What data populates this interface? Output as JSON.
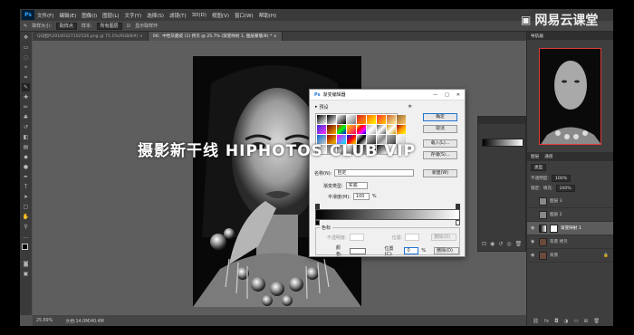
{
  "app": {
    "logo": "Ps"
  },
  "menu": [
    "文件(F)",
    "编辑(E)",
    "图像(I)",
    "图层(L)",
    "文字(Y)",
    "选择(S)",
    "滤镜(T)",
    "3D(D)",
    "视图(V)",
    "窗口(W)",
    "帮助(H)"
  ],
  "options": {
    "size_label": "取样大小:",
    "size_value": "取样点",
    "sample_label": "样本:",
    "sample_value": "所有图层",
    "show_ring": "显示取样环"
  },
  "tabs": [
    {
      "label": "QQ图片20180327102526.png @ 75.1%(RGB/8#)",
      "active": false
    },
    {
      "label": "06：中性灰磨皮 (1) 拷贝 @ 25.7% (渐变映射 1, 图层蒙版/8) *",
      "active": true
    }
  ],
  "status": {
    "zoom": "25.69%",
    "doc": "文档:14.0M/40.4M"
  },
  "panels": {
    "navigator": "导航器",
    "layers_tab": "图层",
    "channels_tab": "通道",
    "kind": "类型",
    "opacity_label": "不透明度:",
    "opacity": "100%",
    "lock": "锁定:",
    "fill_label": "填充:",
    "fill": "100%",
    "layers": [
      {
        "name": "图层 3",
        "selected": false,
        "visible": false
      },
      {
        "name": "图层 2",
        "selected": false,
        "visible": false
      },
      {
        "name": "渐变映射 1",
        "selected": true,
        "visible": true
      },
      {
        "name": "背景 拷贝",
        "selected": false,
        "visible": true
      },
      {
        "name": "背景",
        "selected": false,
        "visible": true
      }
    ]
  },
  "dialog": {
    "title": "渐变编辑器",
    "presets_label": "预设",
    "ok": "确定",
    "cancel": "取消",
    "load": "载入(L)...",
    "save": "存储(S)...",
    "name_label": "名称(N):",
    "name_value": "自定",
    "new_btn": "新建(W)",
    "type_label": "渐变类型:",
    "type_value": "实底",
    "smooth_label": "平滑度(M):",
    "smooth_value": "100",
    "smooth_unit": "%",
    "stops_label": "色标",
    "opacity_label": "不透明度:",
    "loc_label": "位置:",
    "delete": "删除(D)",
    "color_label": "颜色:",
    "loc2_label": "位置(C):",
    "loc2_value": "0",
    "pct": "%",
    "delete2": "删除(D)"
  },
  "watermark": "摄影新干线   HIPHOTOS CLUB VIP",
  "brand": "网易云课堂"
}
